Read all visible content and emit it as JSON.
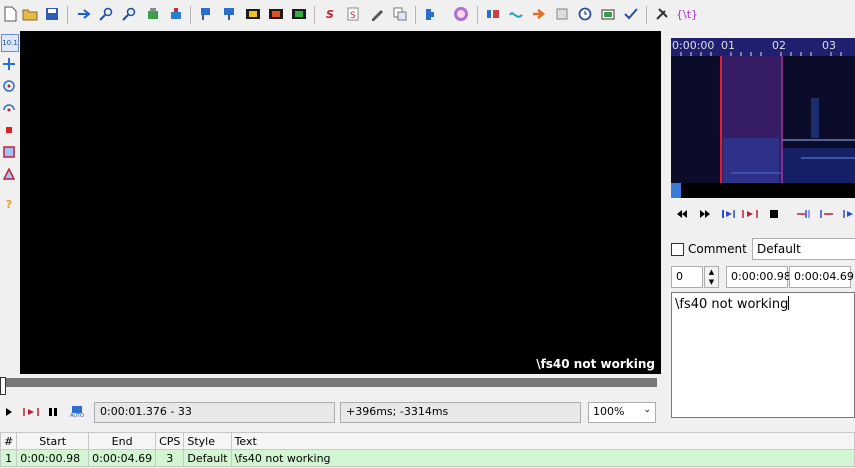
{
  "toolbar": {
    "icons": [
      "new-file-icon",
      "open-folder-icon",
      "save-icon",
      "jump-icon",
      "zoom-in-icon",
      "zoom-out-icon",
      "tag-icon",
      "bucket-icon",
      "style-manager-icon",
      "attachments-icon",
      "video-frame-icon",
      "audio-frame-icon",
      "keyframe-icon",
      "automation-icon",
      "spell-check-icon",
      "pencil-icon",
      "copy-icon",
      "puzzle-icon",
      "avatar-icon",
      "snap-icon",
      "waveform-icon",
      "arrow-icon",
      "stop-square-icon",
      "timer-icon",
      "resolution-icon",
      "check-icon",
      "tools-icon"
    ],
    "tag_text": "{\\t}"
  },
  "left_tools": [
    "standard-tool-icon",
    "move-tool-icon",
    "rotate-z-icon",
    "rotate-xy-icon",
    "scale-tool-icon",
    "clip-tool-icon",
    "vector-clip-icon",
    "help-icon"
  ],
  "left_tools_top_text": "10.1",
  "video": {
    "subtitle": "\\fs40 not working"
  },
  "video_controls": {
    "time_display": "0:00:01.376 - 33",
    "offset_display": "+396ms; -3314ms",
    "zoom": "100%",
    "auto_label": "AUTO"
  },
  "audio": {
    "ruler": [
      "0:00:00",
      "01",
      "02",
      "03"
    ]
  },
  "edit_panel": {
    "comment_label": "Comment",
    "style": "Default",
    "layer": "0",
    "start_time": "0:00:00.98",
    "end_time": "0:00:04.69",
    "text": "\\fs40 not working"
  },
  "grid": {
    "headers": [
      "#",
      "Start",
      "End",
      "CPS",
      "Style",
      "Text"
    ],
    "rows": [
      {
        "num": "1",
        "start": "0:00:00.98",
        "end": "0:00:04.69",
        "cps": "3",
        "style": "Default",
        "text": "\\fs40 not working"
      }
    ]
  },
  "colors": {
    "video_bg": "#000000",
    "row_bg": "#d2f5d2",
    "spectrum_bg": "#0b0b2a"
  }
}
